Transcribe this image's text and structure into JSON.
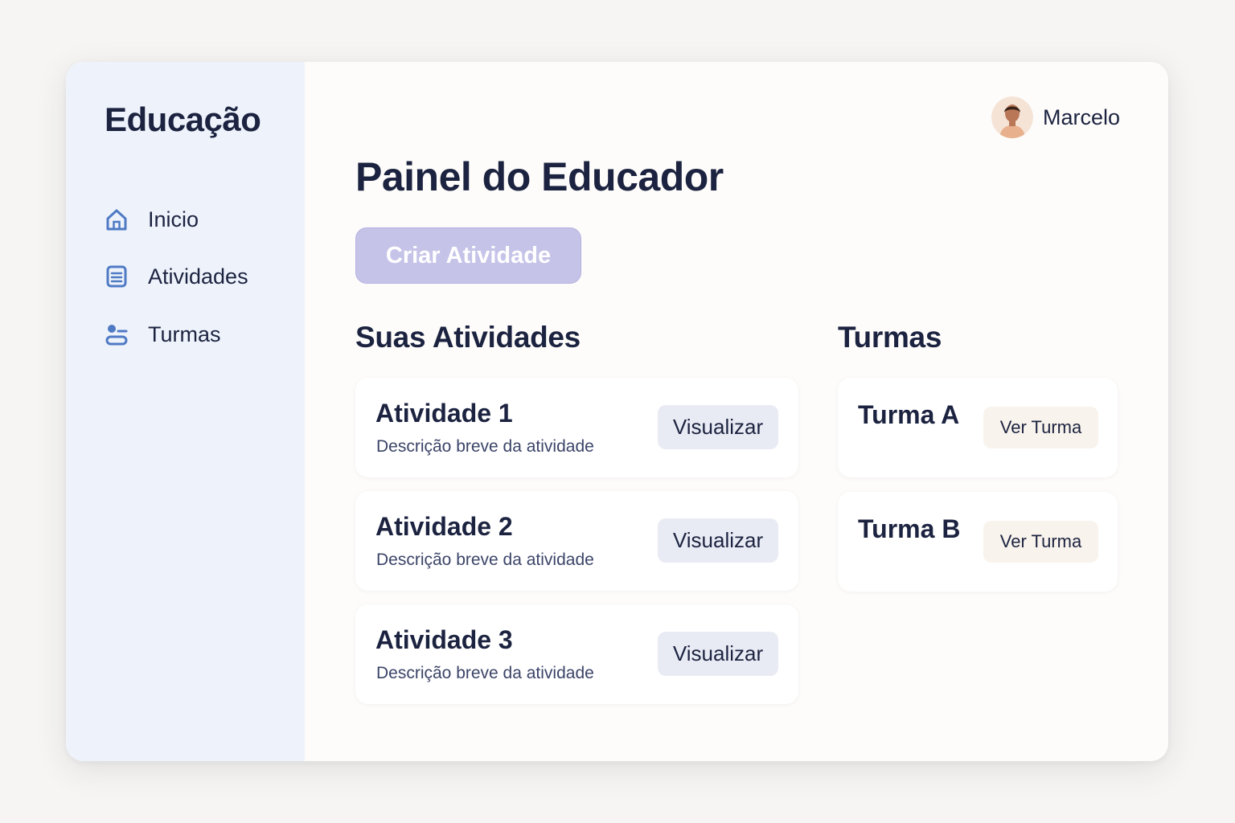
{
  "sidebar": {
    "brand": "Educação",
    "items": [
      {
        "label": "Inicio",
        "icon": "home-icon"
      },
      {
        "label": "Atividades",
        "icon": "list-icon"
      },
      {
        "label": "Turmas",
        "icon": "groups-icon"
      }
    ]
  },
  "header": {
    "user_name": "Marcelo"
  },
  "main": {
    "title": "Painel do Educador",
    "create_button": "Criar Atividade",
    "activities_title": "Suas Atividades",
    "activities": [
      {
        "title": "Atividade 1",
        "description": "Descrição breve da atividade",
        "button": "Visualizar"
      },
      {
        "title": "Atividade 2",
        "description": "Descrição breve da atividade",
        "button": "Visualizar"
      },
      {
        "title": "Atividade 3",
        "description": "Descrição breve da atividade",
        "button": "Visualizar"
      }
    ],
    "classes_title": "Turmas",
    "classes": [
      {
        "title": "Turma A",
        "button": "Ver Turma"
      },
      {
        "title": "Turma B",
        "button": "Ver Turma"
      }
    ]
  },
  "colors": {
    "accent": "#c5c3e8",
    "sidebar_bg": "#eef3fb",
    "icon_blue": "#4f7ac4",
    "text_dark": "#1c2340"
  }
}
